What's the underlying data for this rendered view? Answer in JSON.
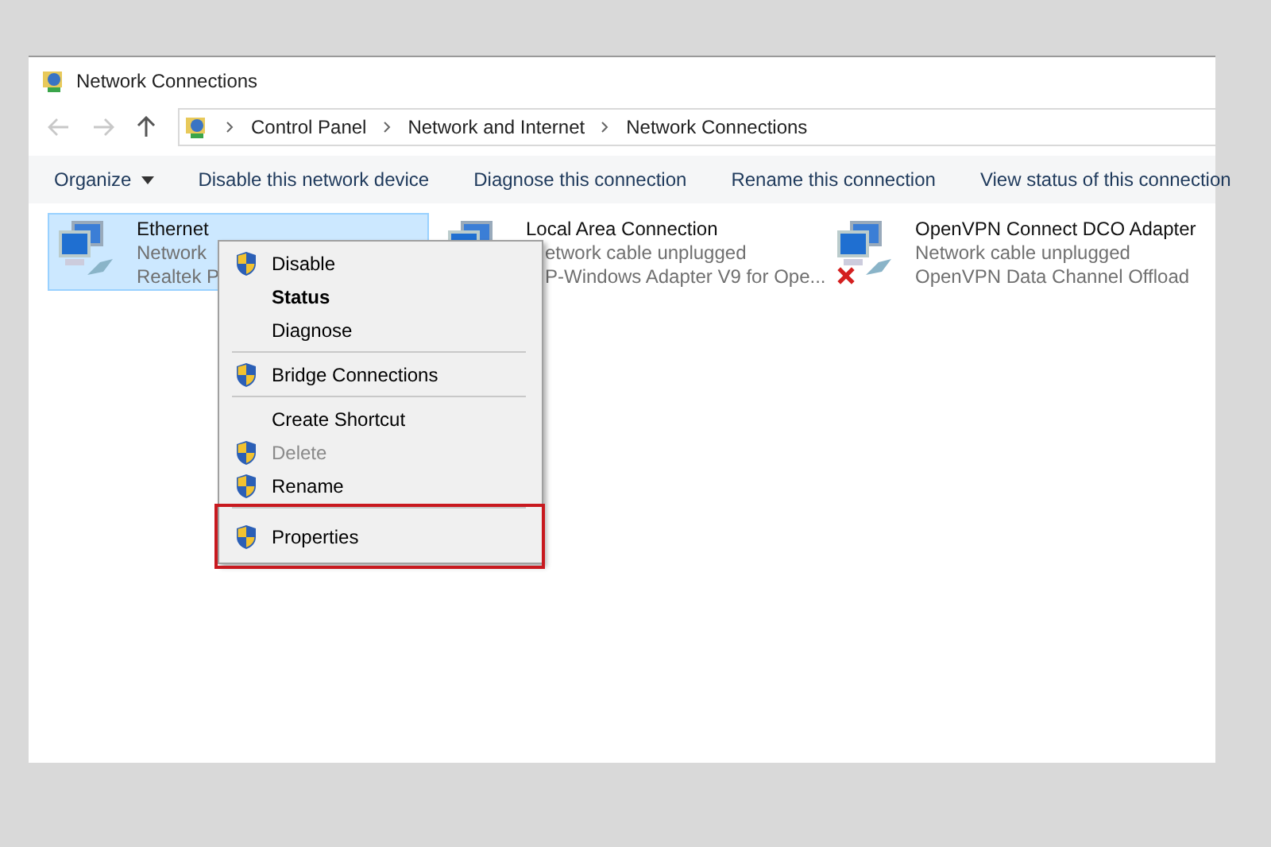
{
  "window": {
    "title": "Network Connections"
  },
  "address_bar": {
    "path": [
      "Control Panel",
      "Network and Internet",
      "Network Connections"
    ]
  },
  "toolbar": [
    {
      "label": "Organize",
      "dropdown": true
    },
    {
      "label": "Disable this network device",
      "dropdown": false
    },
    {
      "label": "Diagnose this connection",
      "dropdown": false
    },
    {
      "label": "Rename this connection",
      "dropdown": false
    },
    {
      "label": "View status of this connection",
      "dropdown": false
    }
  ],
  "adapters": [
    {
      "name": "Ethernet",
      "status": "Network",
      "device": "Realtek P",
      "selected": true,
      "disconnected": false
    },
    {
      "name": "Local Area Connection",
      "status": "etwork cable unplugged",
      "device": "P-Windows Adapter V9 for Ope...",
      "selected": false
    },
    {
      "name": "OpenVPN Connect DCO Adapter",
      "status": "Network cable unplugged",
      "device": "OpenVPN Data Channel Offload",
      "selected": false,
      "disconnected": true
    }
  ],
  "context_menu": [
    {
      "kind": "item",
      "label": "Disable",
      "shield": true,
      "default": false,
      "disabled": false,
      "highlighted": false
    },
    {
      "kind": "item",
      "label": "Status",
      "shield": false,
      "default": true,
      "disabled": false,
      "highlighted": false
    },
    {
      "kind": "item",
      "label": "Diagnose",
      "shield": false,
      "default": false,
      "disabled": false,
      "highlighted": false
    },
    {
      "kind": "separator"
    },
    {
      "kind": "item",
      "label": "Bridge Connections",
      "shield": true,
      "default": false,
      "disabled": false,
      "highlighted": false
    },
    {
      "kind": "separator"
    },
    {
      "kind": "item",
      "label": "Create Shortcut",
      "shield": false,
      "default": false,
      "disabled": false,
      "highlighted": false
    },
    {
      "kind": "item",
      "label": "Delete",
      "shield": true,
      "default": false,
      "disabled": true,
      "highlighted": false
    },
    {
      "kind": "item",
      "label": "Rename",
      "shield": true,
      "default": false,
      "disabled": false,
      "highlighted": false
    },
    {
      "kind": "separator"
    },
    {
      "kind": "item",
      "label": "Properties",
      "shield": true,
      "default": false,
      "disabled": false,
      "highlighted": true
    }
  ]
}
